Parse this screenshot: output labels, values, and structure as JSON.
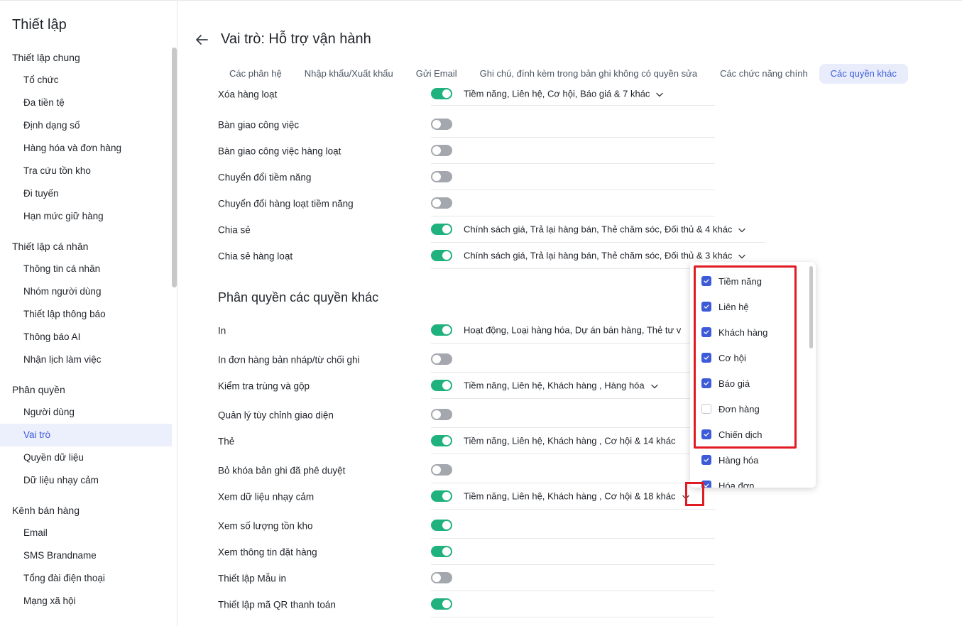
{
  "sidebar": {
    "title": "Thiết lập",
    "groups": [
      {
        "label": "Thiết lập chung",
        "items": [
          "Tổ chức",
          "Đa tiền tệ",
          "Định dạng số",
          "Hàng hóa và đơn hàng",
          "Tra cứu tồn kho",
          "Đi tuyến",
          "Hạn mức giữ hàng"
        ]
      },
      {
        "label": "Thiết lập cá nhân",
        "items": [
          "Thông tin cá nhân",
          "Nhóm người dùng",
          "Thiết lập thông báo",
          "Thông báo AI",
          "Nhận lịch làm việc"
        ]
      },
      {
        "label": "Phân quyền",
        "items": [
          "Người dùng",
          "Vai trò",
          "Quyền dữ liệu",
          "Dữ liệu nhạy cảm"
        ]
      },
      {
        "label": "Kênh bán hàng",
        "items": [
          "Email",
          "SMS Brandname",
          "Tổng đài điện thoại",
          "Mạng xã hội"
        ]
      }
    ],
    "active_item": "Vai trò"
  },
  "header": {
    "title": "Vai trò: Hỗ trợ vận hành"
  },
  "tabs": [
    {
      "label": "Các phân hệ",
      "active": false
    },
    {
      "label": "Nhập khẩu/Xuất khẩu",
      "active": false
    },
    {
      "label": "Gửi Email",
      "active": false
    },
    {
      "label": "Ghi chú, đính kèm trong bản ghi không có quyền sửa",
      "active": false
    },
    {
      "label": "Các chức năng chính",
      "active": false
    },
    {
      "label": "Các quyền khác",
      "active": true
    }
  ],
  "rows_top": [
    {
      "label": "Xóa hàng loạt",
      "on": true,
      "value": "Tiềm năng, Liên hệ, Cơ hội, Báo giá & 7 khác",
      "dropdown": true
    },
    {
      "label": "Bàn giao công việc",
      "on": false,
      "value": "",
      "dropdown": false
    },
    {
      "label": "Bàn giao công việc hàng loạt",
      "on": false,
      "value": "",
      "dropdown": false
    },
    {
      "label": "Chuyển đổi tiềm năng",
      "on": false,
      "value": "",
      "dropdown": false
    },
    {
      "label": "Chuyển đổi hàng loạt tiềm năng",
      "on": false,
      "value": "",
      "dropdown": false
    },
    {
      "label": "Chia sẻ",
      "on": true,
      "value": "Chính sách giá, Trả lại hàng bán, Thẻ chăm sóc, Đối thủ & 4 khác",
      "dropdown": true
    },
    {
      "label": "Chia sẻ hàng loạt",
      "on": true,
      "value": "Chính sách giá, Trả lại hàng bán, Thẻ chăm sóc, Đối thủ & 3 khác",
      "dropdown": true
    }
  ],
  "section_title": "Phân quyền các quyền khác",
  "rows_bottom": [
    {
      "label": "In",
      "on": true,
      "value": "Hoạt động, Loại hàng hóa, Dự án bán hàng, Thẻ tư v",
      "dropdown": false
    },
    {
      "label": "In đơn hàng bản nháp/từ chối ghi",
      "on": false,
      "value": "",
      "dropdown": false
    },
    {
      "label": "Kiểm tra trùng và gộp",
      "on": true,
      "value": "Tiềm năng, Liên hệ, Khách hàng , Hàng hóa",
      "dropdown": true
    },
    {
      "label": "Quản lý tùy chỉnh giao diện",
      "on": false,
      "value": "",
      "dropdown": false
    },
    {
      "label": "Thẻ",
      "on": true,
      "value": "Tiềm năng, Liên hệ, Khách hàng , Cơ hội & 14 khác",
      "dropdown": false
    },
    {
      "label": "Bỏ khóa bản ghi đã phê duyệt",
      "on": false,
      "value": "",
      "dropdown": false
    },
    {
      "label": "Xem dữ liệu nhạy cảm",
      "on": true,
      "value": "Tiềm năng, Liên hệ, Khách hàng , Cơ hội & 18 khác",
      "dropdown": true
    },
    {
      "label": "Xem số lượng tồn kho",
      "on": true,
      "value": "",
      "dropdown": false
    },
    {
      "label": "Xem thông tin đặt hàng",
      "on": true,
      "value": "",
      "dropdown": false
    },
    {
      "label": "Thiết lập Mẫu in",
      "on": false,
      "value": "",
      "dropdown": false
    },
    {
      "label": "Thiết lập mã QR thanh toán",
      "on": true,
      "value": "",
      "dropdown": false
    }
  ],
  "dropdown_options": [
    {
      "label": "Tiềm năng",
      "checked": true
    },
    {
      "label": "Liên hệ",
      "checked": true
    },
    {
      "label": "Khách hàng",
      "checked": true
    },
    {
      "label": "Cơ hội",
      "checked": true
    },
    {
      "label": "Báo giá",
      "checked": true
    },
    {
      "label": "Đơn hàng",
      "checked": false
    },
    {
      "label": "Chiến dịch",
      "checked": true
    },
    {
      "label": "Hàng hóa",
      "checked": true
    },
    {
      "label": "Hóa đơn",
      "checked": true
    }
  ],
  "colors": {
    "accent": "#3d5bd9",
    "toggle_on": "#1fb17e",
    "toggle_off": "#a4a7ae",
    "highlight": "#e01b24"
  }
}
